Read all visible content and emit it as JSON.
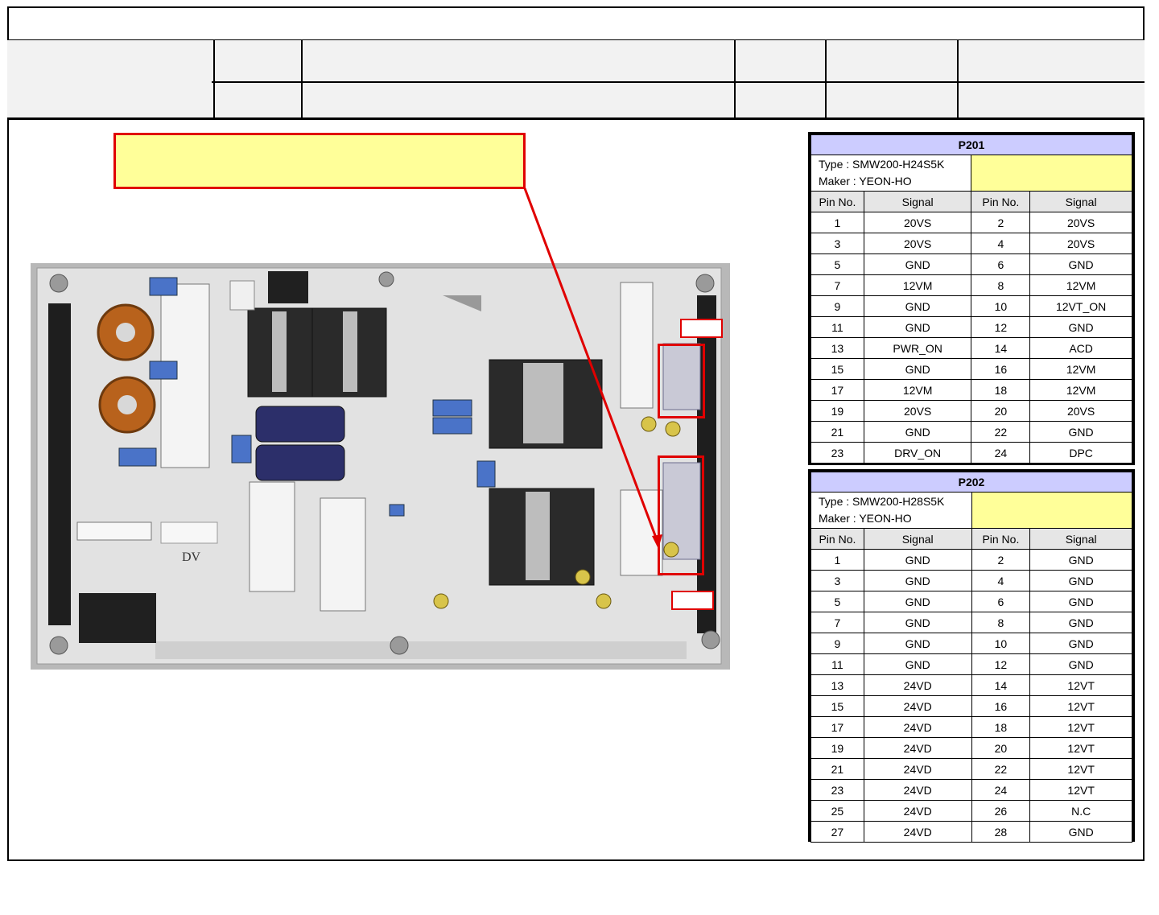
{
  "p201": {
    "title": "P201",
    "type": "Type : SMW200-H24S5K",
    "maker": "Maker : YEON-HO",
    "headers": [
      "Pin No.",
      "Signal",
      "Pin No.",
      "Signal"
    ],
    "rows": [
      [
        "1",
        "20VS",
        "2",
        "20VS"
      ],
      [
        "3",
        "20VS",
        "4",
        "20VS"
      ],
      [
        "5",
        "GND",
        "6",
        "GND"
      ],
      [
        "7",
        "12VM",
        "8",
        "12VM"
      ],
      [
        "9",
        "GND",
        "10",
        "12VT_ON"
      ],
      [
        "11",
        "GND",
        "12",
        "GND"
      ],
      [
        "13",
        "PWR_ON",
        "14",
        "ACD"
      ],
      [
        "15",
        "GND",
        "16",
        "12VM"
      ],
      [
        "17",
        "12VM",
        "18",
        "12VM"
      ],
      [
        "19",
        "20VS",
        "20",
        "20VS"
      ],
      [
        "21",
        "GND",
        "22",
        "GND"
      ],
      [
        "23",
        "DRV_ON",
        "24",
        "DPC"
      ]
    ]
  },
  "p202": {
    "title": "P202",
    "type": "Type : SMW200-H28S5K",
    "maker": "Maker : YEON-HO",
    "headers": [
      "Pin No.",
      "Signal",
      "Pin No.",
      "Signal"
    ],
    "rows": [
      [
        "1",
        "GND",
        "2",
        "GND"
      ],
      [
        "3",
        "GND",
        "4",
        "GND"
      ],
      [
        "5",
        "GND",
        "6",
        "GND"
      ],
      [
        "7",
        "GND",
        "8",
        "GND"
      ],
      [
        "9",
        "GND",
        "10",
        "GND"
      ],
      [
        "11",
        "GND",
        "12",
        "GND"
      ],
      [
        "13",
        "24VD",
        "14",
        "12VT"
      ],
      [
        "15",
        "24VD",
        "16",
        "12VT"
      ],
      [
        "17",
        "24VD",
        "18",
        "12VT"
      ],
      [
        "19",
        "24VD",
        "20",
        "12VT"
      ],
      [
        "21",
        "24VD",
        "22",
        "12VT"
      ],
      [
        "23",
        "24VD",
        "24",
        "12VT"
      ],
      [
        "25",
        "24VD",
        "26",
        "N.C"
      ],
      [
        "27",
        "24VD",
        "28",
        "GND"
      ]
    ]
  },
  "board": {
    "marking": "DV"
  },
  "colors": {
    "callout_fill": "#ffff99",
    "highlight": "#e00000",
    "table_title": "#ccccff",
    "pcb": "#e4e4e4"
  }
}
